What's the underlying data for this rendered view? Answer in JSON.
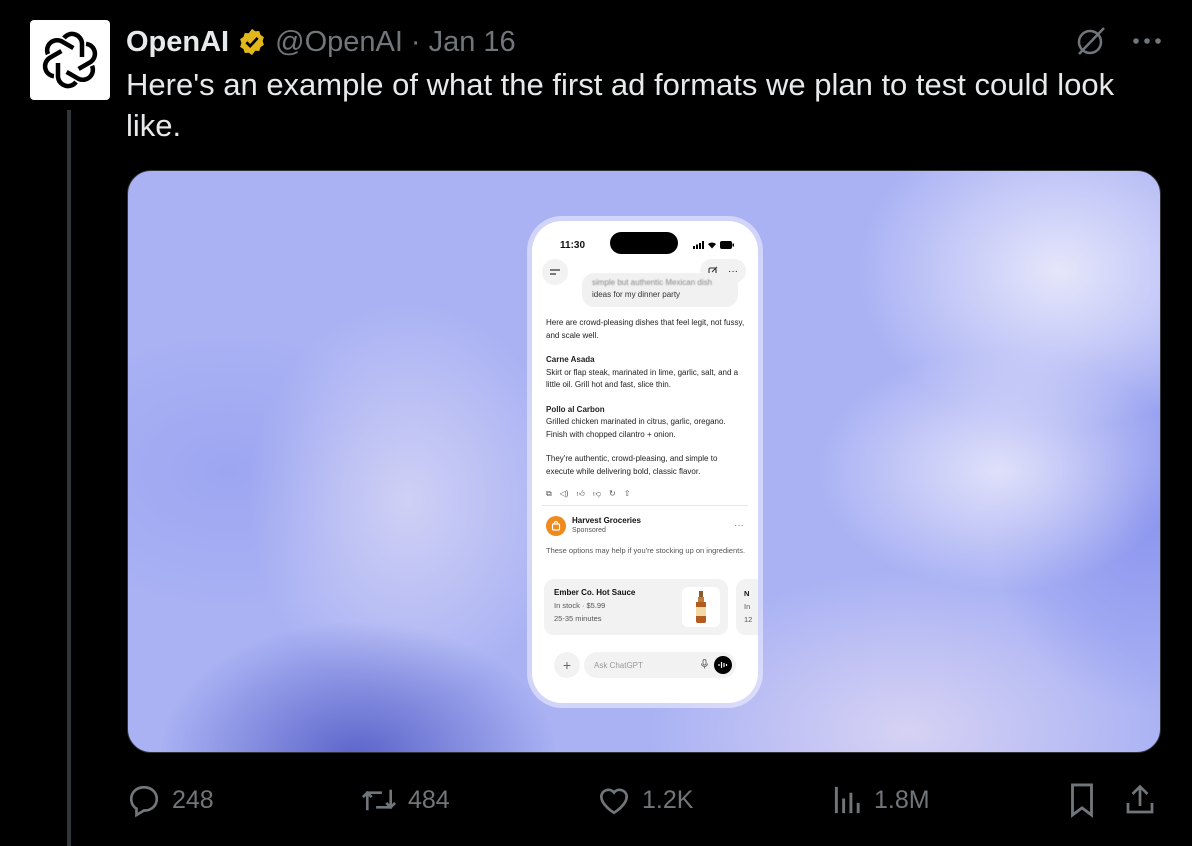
{
  "tweet": {
    "author_name": "OpenAI",
    "handle": "@OpenAI",
    "separator": "·",
    "date": "Jan 16",
    "text": "Here's an example of what the first ad formats we plan to test could look like."
  },
  "media": {
    "phone": {
      "time": "11:30",
      "user_message_line1": "simple but authentic Mexican dish",
      "user_message_line2": "ideas for my dinner party",
      "reply_intro": "Here are crowd-pleasing dishes that feel legit, not fussy, and scale well.",
      "dish1_title": "Carne Asada",
      "dish1_desc": "Skirt or flap steak, marinated in lime, garlic, salt, and a little oil. Grill hot and fast, slice thin.",
      "dish2_title": "Pollo al Carbon",
      "dish2_desc": "Grilled chicken marinated in citrus, garlic, oregano. Finish with chopped cilantro + onion.",
      "reply_outro": "They're authentic, crowd-pleasing, and simple to execute while delivering bold, classic flavor.",
      "ad": {
        "brand": "Harvest Groceries",
        "label": "Sponsored",
        "description": "These options may help if you're stocking up on ingredients.",
        "product_name": "Ember Co. Hot Sauce",
        "product_stock": "In stock · $5.99",
        "product_delivery": "25-35 minutes",
        "next_card_line1": "N",
        "next_card_line2": "In",
        "next_card_line3": "12"
      },
      "composer_placeholder": "Ask ChatGPT"
    }
  },
  "metrics": {
    "replies": "248",
    "reposts": "484",
    "likes": "1.2K",
    "views": "1.8M"
  },
  "colors": {
    "background": "#000000",
    "text": "#e7e9ea",
    "muted": "#71767b",
    "verified_gold": "#e2b719",
    "media_lavender": "#aab2f4",
    "ad_orange": "#f08a1c"
  }
}
